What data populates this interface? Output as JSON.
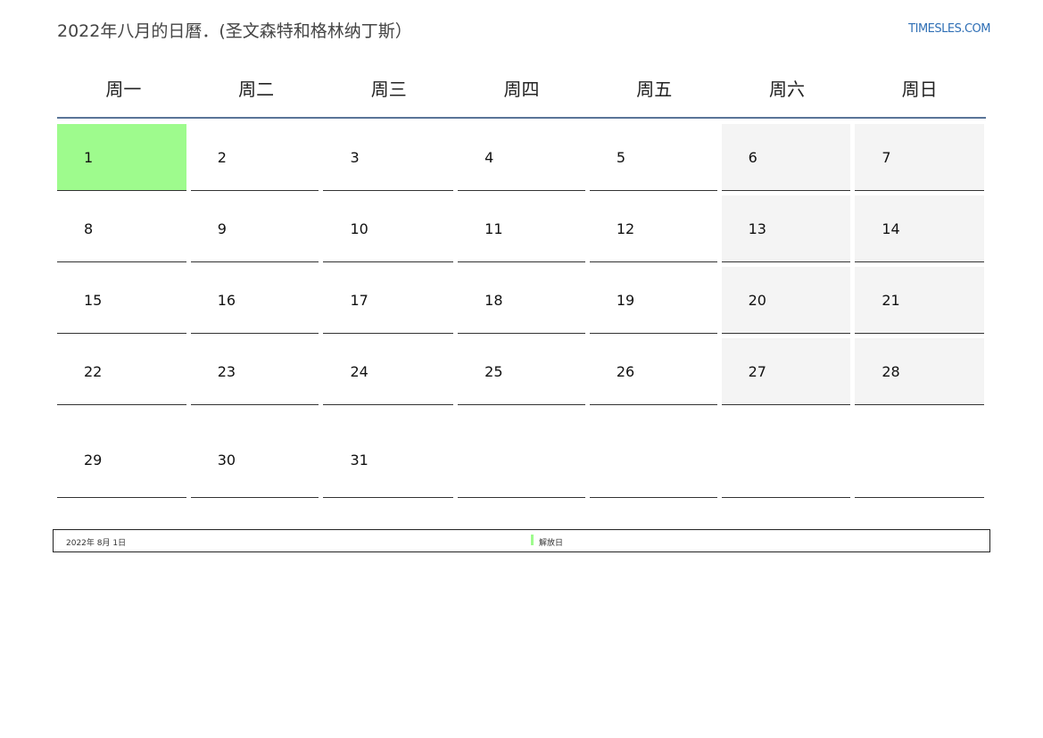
{
  "header": {
    "title": "2022年八月的日曆．(圣文森特和格林纳丁斯）",
    "site": "TIMESLES.COM"
  },
  "weekdays": [
    "周一",
    "周二",
    "周三",
    "周四",
    "周五",
    "周六",
    "周日"
  ],
  "weeks": [
    [
      "1",
      "2",
      "3",
      "4",
      "5",
      "6",
      "7"
    ],
    [
      "8",
      "9",
      "10",
      "11",
      "12",
      "13",
      "14"
    ],
    [
      "15",
      "16",
      "17",
      "18",
      "19",
      "20",
      "21"
    ],
    [
      "22",
      "23",
      "24",
      "25",
      "26",
      "27",
      "28"
    ],
    [
      "29",
      "30",
      "31",
      "",
      "",
      "",
      ""
    ]
  ],
  "holiday_color": "#9efb8d",
  "legend": {
    "date": "2022年 8月 1日",
    "name": "解放日"
  }
}
